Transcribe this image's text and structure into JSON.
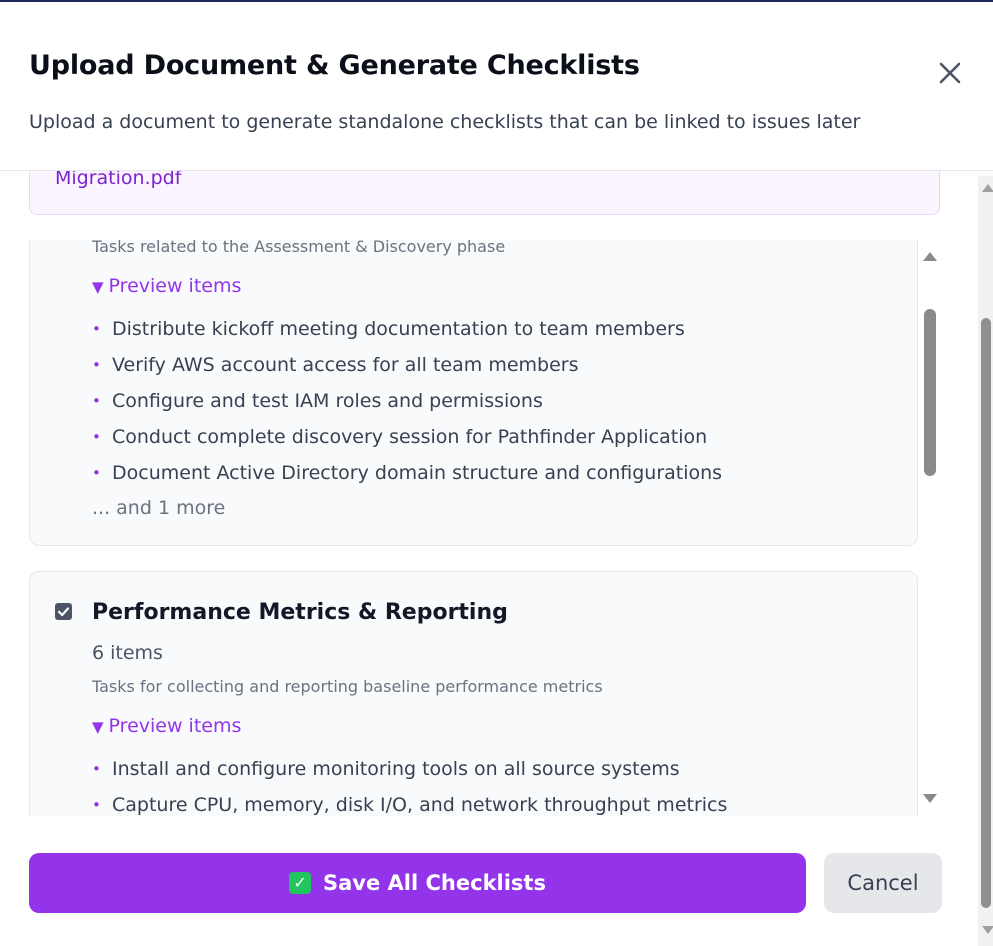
{
  "dialog": {
    "title": "Upload Document & Generate Checklists",
    "subtitle": "Upload a document to generate standalone checklists that can be linked to issues later",
    "close_icon": "close-icon"
  },
  "file": {
    "name": "Migration.pdf"
  },
  "checklists": [
    {
      "description": "Tasks related to the Assessment & Discovery phase",
      "preview_label": "Preview items",
      "items": [
        "Distribute kickoff meeting documentation to team members",
        "Verify AWS account access for all team members",
        "Configure and test IAM roles and permissions",
        "Conduct complete discovery session for Pathfinder Application",
        "Document Active Directory domain structure and configurations"
      ],
      "more": "... and 1 more"
    },
    {
      "checked": true,
      "title": "Performance Metrics & Reporting",
      "count": "6 items",
      "description": "Tasks for collecting and reporting baseline performance metrics",
      "preview_label": "Preview items",
      "items": [
        "Install and configure monitoring tools on all source systems",
        "Capture CPU, memory, disk I/O, and network throughput metrics"
      ]
    }
  ],
  "bullet": "•",
  "toggle_glyph": "▼",
  "footer": {
    "save_label": "Save All Checklists",
    "save_icon": "✓",
    "cancel_label": "Cancel"
  },
  "colors": {
    "accent": "#9333ea",
    "save_check_bg": "#22c55e"
  }
}
